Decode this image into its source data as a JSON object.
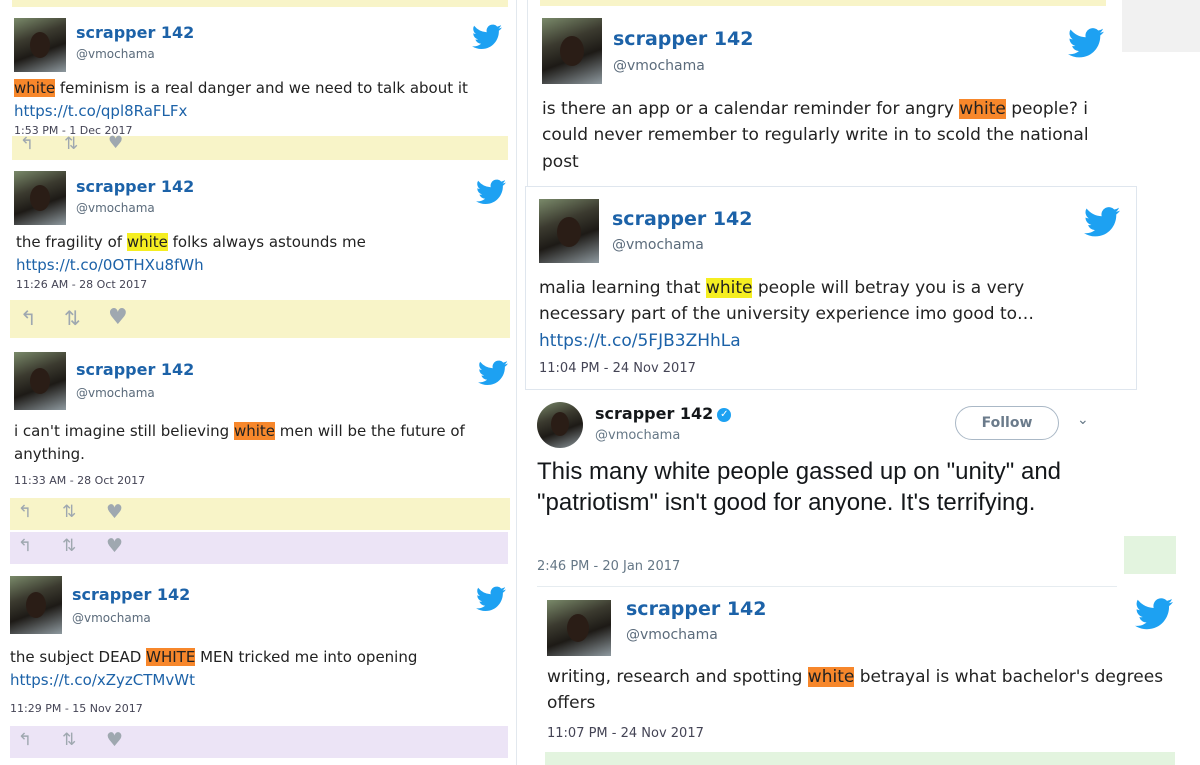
{
  "tweets": {
    "t1": {
      "name": "scrapper 142",
      "handle": "@vmochama",
      "hl": "white",
      "text_after": " feminism is a real danger and we need to talk about it",
      "link": "https://t.co/qpl8RaFLFx",
      "time": "1:53 PM - 1 Dec 2017"
    },
    "t2": {
      "name": "scrapper 142",
      "handle": "@vmochama",
      "text_before": "the fragility of ",
      "hl": "white",
      "text_after": " folks always astounds me",
      "link": "https://t.co/0OTHXu8fWh",
      "time": "11:26 AM - 28 Oct 2017"
    },
    "t3": {
      "name": "scrapper 142",
      "handle": "@vmochama",
      "text_before": "i can't imagine still believing ",
      "hl": "white",
      "text_after": " men will be the future of anything.",
      "time": "11:33 AM - 28 Oct 2017"
    },
    "t4": {
      "name": "scrapper 142",
      "handle": "@vmochama",
      "text_before": "the subject DEAD ",
      "hl": "WHITE",
      "text_after": " MEN tricked me into opening",
      "link": "https://t.co/xZyzCTMvWt",
      "time": "11:29 PM - 15 Nov 2017"
    },
    "t5": {
      "name": "scrapper 142",
      "handle": "@vmochama",
      "text_before": "is there an app or a calendar reminder for angry ",
      "hl": "white",
      "text_after": " people? i could never remember to regularly write in to scold the national post"
    },
    "t6": {
      "name": "scrapper 142",
      "handle": "@vmochama",
      "text_before": "malia learning that ",
      "hl": "white",
      "text_after": " people will betray you is a very necessary part of the university experience imo good to…",
      "link": "https://t.co/5FJB3ZHhLa",
      "time": "11:04 PM - 24 Nov 2017"
    },
    "t7": {
      "name": "scrapper 142",
      "handle": "@vmochama",
      "follow_label": "Follow",
      "text": "This many white people gassed up on \"unity\" and \"patriotism\" isn't good for anyone. It's terrifying.",
      "time": "2:46 PM - 20 Jan 2017"
    },
    "t8": {
      "name": "scrapper 142",
      "handle": "@vmochama",
      "text_before": "writing, research and spotting ",
      "hl": "white",
      "text_after": " betrayal is what bachelor's degrees offers",
      "time": "11:07 PM - 24 Nov 2017"
    }
  },
  "colors": {
    "name_blue": "#1c62a8",
    "twitter_blue": "#1da1f2",
    "highlight_orange": "#f7872b",
    "highlight_yellow": "#f5ee21",
    "bar_yellow": "#f8f4c8",
    "bar_lavender": "#ece4f6",
    "bar_green": "#e3f4df"
  },
  "icons": [
    "reply-icon",
    "retweet-icon",
    "like-icon",
    "twitter-bird-icon",
    "verified-icon",
    "chevron-down-icon"
  ]
}
